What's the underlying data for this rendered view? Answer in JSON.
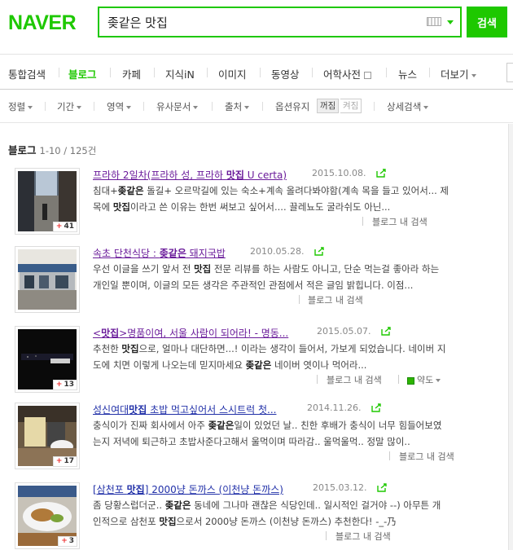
{
  "header": {
    "logo": "NAVER",
    "search_value": "좆같은 맛집",
    "search_button": "검색"
  },
  "tabs": [
    {
      "label": "통합검색"
    },
    {
      "label": "블로그"
    },
    {
      "label": "카페"
    },
    {
      "label": "지식iN"
    },
    {
      "label": "이미지"
    },
    {
      "label": "동영상"
    },
    {
      "label": "어학사전"
    },
    {
      "label": "뉴스"
    },
    {
      "label": "더보기"
    }
  ],
  "filters": {
    "sort": "정렬",
    "period": "기간",
    "area": "영역",
    "similar": "유사문서",
    "source": "출처",
    "option_keep": "옵션유지",
    "toggle_on": "꺼짐",
    "toggle_off": "켜짐",
    "detail": "상세검색"
  },
  "results": {
    "heading": "블로그",
    "count": "1-10 / 125건",
    "items": [
      {
        "title": "프라하 2일차(프라하 성, 프라하 맛집 U certa)",
        "date": "2015.10.08.",
        "desc1": "침대+좆같은 돌길+ 오르막길에 있는 숙소+계속 올려다봐야함(계속 목을 들고 있어서... 제",
        "desc2": "목에 맛집이라고 쓴 이유는 한번 써보고 싶어서.... 끌레뇨도 굴라쉬도 아닌...",
        "meta": "블로그 내 검색",
        "badge": "41"
      },
      {
        "title": "속초 단천식당 : 좆같은 돼지국밥",
        "date": "2010.05.28.",
        "desc1": "우선 이글을 쓰기 앞서 전 맛집 전문 리뷰를 하는 사람도 아니고, 단순 먹는걸 좋아라 하는",
        "desc2": "개인일 뿐이며, 이글의 모든 생각은 주관적인 관점에서 적은 글임 밝힙니다. 이점...",
        "meta": "블로그 내 검색",
        "badge": ""
      },
      {
        "title": "<맛집>명품이여, 서울 사람이 되어라! - 명동...",
        "date": "2015.05.07.",
        "desc1": "추천한 맛집으로, 얼마나 대단하면...! 이라는 생각이 들어서, 가보게 되었습니다. 네이버 지",
        "desc2": "도에 치면 이렇게 나오는데 믿지마세요 좆같은 네이버 엿이나 먹어라...",
        "meta": "블로그 내 검색",
        "extra": "약도",
        "badge": "13"
      },
      {
        "title": "성신여대맛집 초밥 먹고싶어서 스시트럭 첫...",
        "date": "2014.11.26.",
        "desc1": "충식이가 진짜 회사에서 아주 좆같은일이 있었던 날.. 친한 후배가 충식이 너무 힘들어보였",
        "desc2": "는지 저녁에 퇴근하고 초밥사준다고해서 울먹이며 따라감.. 울먹울먹.. 정말 많이..",
        "meta": "블로그 내 검색",
        "badge": "17"
      },
      {
        "title": "[삼천포 맛집] 2000냥 돈까스 (이천냥 돈까스)",
        "date": "2015.03.12.",
        "desc1": "좀 당황스럽더군.. 좆같은 동네에 그나마 괜찮은 식당인데.. 일시적인 걸거야 --) 아무튼 개",
        "desc2": "인적으로 삼천포 맛집으로서 2000냥 돈까스 (이천냥 돈까스) 추천한다! -_-乃",
        "meta": "블로그 내 검색",
        "badge": "3"
      }
    ]
  },
  "colors": {
    "brand": "#1ec800",
    "title_visited": "#6a1b9a",
    "title_link": "#2130a8"
  }
}
